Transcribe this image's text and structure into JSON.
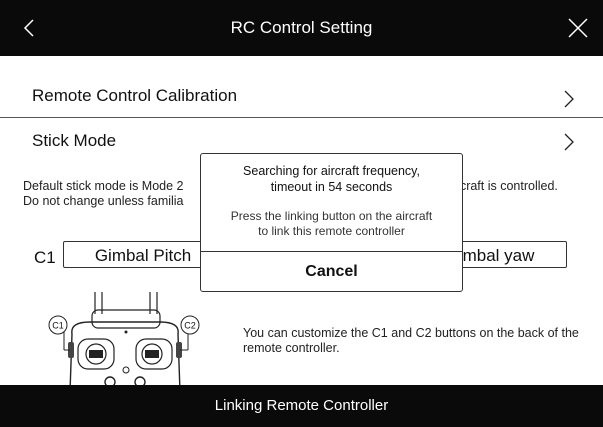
{
  "header": {
    "title": "RC Control Setting"
  },
  "settings": {
    "calibration_label": "Remote Control Calibration",
    "stick_mode_label": "Stick Mode",
    "note_line1_left": "Default stick mode is Mode 2",
    "note_line1_right": "ircraft is controlled.",
    "note_line2": "Do not change unless familia",
    "c1_label": "C1",
    "c1_value": "Gimbal Pitch",
    "c2_value": "mbal yaw",
    "customize_hint": "You can customize the C1 and C2 buttons on the back of the remote controller.",
    "controller_labels": {
      "c1": "C1",
      "c2": "C2"
    }
  },
  "dialog": {
    "message": "Searching for aircraft frequency,\ntimeout in 54 seconds",
    "instruction": "Press the linking button on the aircraft\nto link this remote controller",
    "cancel_label": "Cancel"
  },
  "footer": {
    "label": "Linking Remote Controller"
  },
  "colors": {
    "bar": "#0a0a0a",
    "background": "#ffffff",
    "text": "#111111"
  }
}
